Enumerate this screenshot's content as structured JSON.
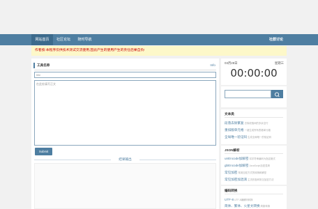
{
  "nav": {
    "items": [
      "网站首页",
      "社区论坛",
      "随时导航"
    ],
    "right": "社群讨论"
  },
  "notice": "作者按:本程序仅供技术测试交流使用,因此产生的使用产生的责任后果自负!",
  "main": {
    "header_title": "工具名称",
    "header_info": "Info",
    "title_placeholder": "title",
    "content_placeholder": "在此处填写正文",
    "submit_label": "Submit",
    "result_title": "结果输出"
  },
  "clock": {
    "date": "03月28日",
    "weekday": "星期三",
    "time": "00:00:00"
  },
  "sidebar": {
    "text_tools": {
      "title": "文本类",
      "items": [
        {
          "label": "段落去除繁复",
          "desc": "去除段落间的多余空行"
        },
        {
          "label": "重排版单元格",
          "desc": "一键生成所有表格单元格"
        },
        {
          "label": "全局唯一验证码",
          "desc": "生成全局唯一的验证码"
        }
      ]
    },
    "json_tools": {
      "title": "JSON解析",
      "items": [
        {
          "label": "unEncode加解密",
          "desc": "将字符串编码为指定格式"
        },
        {
          "label": "gbEncode加解密",
          "desc": "JavaScript加密混淆"
        },
        {
          "label": "常见加密",
          "desc": "常用加密方式的转换和解密"
        },
        {
          "label": "常见加密加混淆",
          "desc": "主流的各种常见加密方法"
        }
      ]
    },
    "encode_tools": {
      "title": "编码转换",
      "items": [
        {
          "label": "UTF-8",
          "desc": "UTF-8编解码转换"
        },
        {
          "label": "简体、繁体、火星文转换",
          "desc": "简繁转换"
        }
      ]
    }
  }
}
